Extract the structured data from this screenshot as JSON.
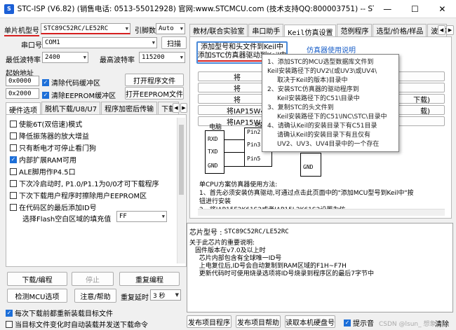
{
  "window": {
    "title": "STC-ISP (V6.82) (销售电话: 0513-55012928) 官网:www.STCMCU.com (技术支持QQ:800003751) -- STC: 全球最大的80...",
    "icon_text": "S",
    "minimize": "—",
    "maximize": "☐",
    "close": "✕"
  },
  "left": {
    "chip_label": "单片机型号",
    "chip_value": "STC89C52RC/LE52RC",
    "pins_label": "引脚数",
    "pins_value": "Auto",
    "port_label": "串口号",
    "port_value": "COM1",
    "scan_button": "扫描",
    "min_baud_label": "最低波特率",
    "min_baud_value": "2400",
    "max_baud_label": "最高波特率",
    "max_baud_value": "115200",
    "start_addr_label": "起始地址",
    "addr1_value": "0x0000",
    "clear_code_label": "清除代码缓冲区",
    "open_prog_button": "打开程序文件",
    "addr2_value": "0x2000",
    "clear_eeprom_label": "清除EEPROM缓冲区",
    "open_eeprom_button": "打开EEPROM文件",
    "tabs": [
      "硬件选项",
      "脱机下载/U8/U7",
      "程序加密后传输",
      "下载"
    ],
    "options": [
      {
        "label": "使能6T(双倍速)模式",
        "checked": false
      },
      {
        "label": "降低振荡器的放大增益",
        "checked": false
      },
      {
        "label": "只有断电才可停止看门狗",
        "checked": false
      },
      {
        "label": "内部扩展RAM可用",
        "checked": true
      },
      {
        "label": "ALE脚用作P4.5口",
        "checked": false
      },
      {
        "label": "下次冷启动时, P1.0/P1.1为0/0才可下载程序",
        "checked": false
      },
      {
        "label": "下次下载用户程序时擦除用户EEPROM区",
        "checked": false
      },
      {
        "label": "在代码区的最后添加ID号",
        "checked": false
      }
    ],
    "fill_label": "选择Flash空白区域的填充值",
    "fill_value": "FF",
    "download_button": "下载/编程",
    "stop_button": "停止",
    "reprogram_button": "重复编程",
    "detect_button": "检测MCU选项",
    "help_button": "注意/帮助",
    "repeat_delay_label": "重复延时",
    "repeat_delay_value": "3 秒",
    "reload_label": "每次下载前都重新装载目标文件",
    "autoload_label": "当目标文件变化时自动装载并发送下载命令"
  },
  "right": {
    "tabs": [
      "教材/联合实验室",
      "串口助手",
      "Keil仿真设置",
      "范例程序",
      "选型/价格/样品",
      "波特率"
    ],
    "add_model_button_line1": "添加型号和头文件到Keil中",
    "add_model_button_line2": "添加STC仿真器驱动到Keil中",
    "emulator_help": "仿真器使用说明",
    "iap_buttons": [
      "将",
      "将",
      "将",
      "将IAP15W4K",
      "将IAP15W4K"
    ],
    "iap_suffix_1": "下载)",
    "iap_suffix_2": "载)",
    "diagram": {
      "title": "电脑",
      "rs2": "RS2",
      "pins": [
        "RXD",
        "TXD",
        "GND"
      ],
      "chip_pins": [
        "Pin2",
        "Pin3",
        "Pin5"
      ],
      "gnd": "GND"
    },
    "usage_title": "单CPU方案仿真器使用方法:",
    "usage_1": "1、首先必须安装仿真驱动,可通过点击此页面中的\"添加MCU型号到Keil中\"按",
    "usage_2": "钮进行安装",
    "usage_3": "2、将IAP15F2K61S2或者IAP15L2K61S2设置为仿",
    "tooltip": [
      "1、添加STC的MCU选型数据库文件到",
      "Keil安装路径下的UV2\\(或UV3\\或UV4\\",
      "取决于Keil的版本)目录中",
      "2、安装STC仿真器的驱动程序到",
      "Keil安装路径下的C51\\目录中",
      "3、复制STC的头文件到",
      "Keil安装路径下的C51\\INC\\STC\\目录中",
      "4、请确认Keil的安装目录下有C51目录",
      "请确认Keil的安装目录下有且仅有",
      "UV2、UV3、UV4目录中的一个存在"
    ],
    "chip_model_label": "芯片型号 :",
    "chip_model_value": "STC89C52RC/LE52RC",
    "notes_title": "关于此芯片的重要说明:",
    "notes": [
      "固件版本在v7.0及以上时",
      "  芯片内部包含有全球唯一ID号",
      "  上电复位后,ID号会自动复制到RAM区域的F1H~F7H",
      "  更新代码时可使用烧录选项将ID号烧录到程序区的最后7字节中"
    ],
    "bottom_buttons": [
      "发布项目程序",
      "发布项目帮助",
      "读取本机硬盘号"
    ],
    "beep_label": "提示音",
    "watermark": "CSDN @lsun_ 想象",
    "clear_label": "清除"
  }
}
